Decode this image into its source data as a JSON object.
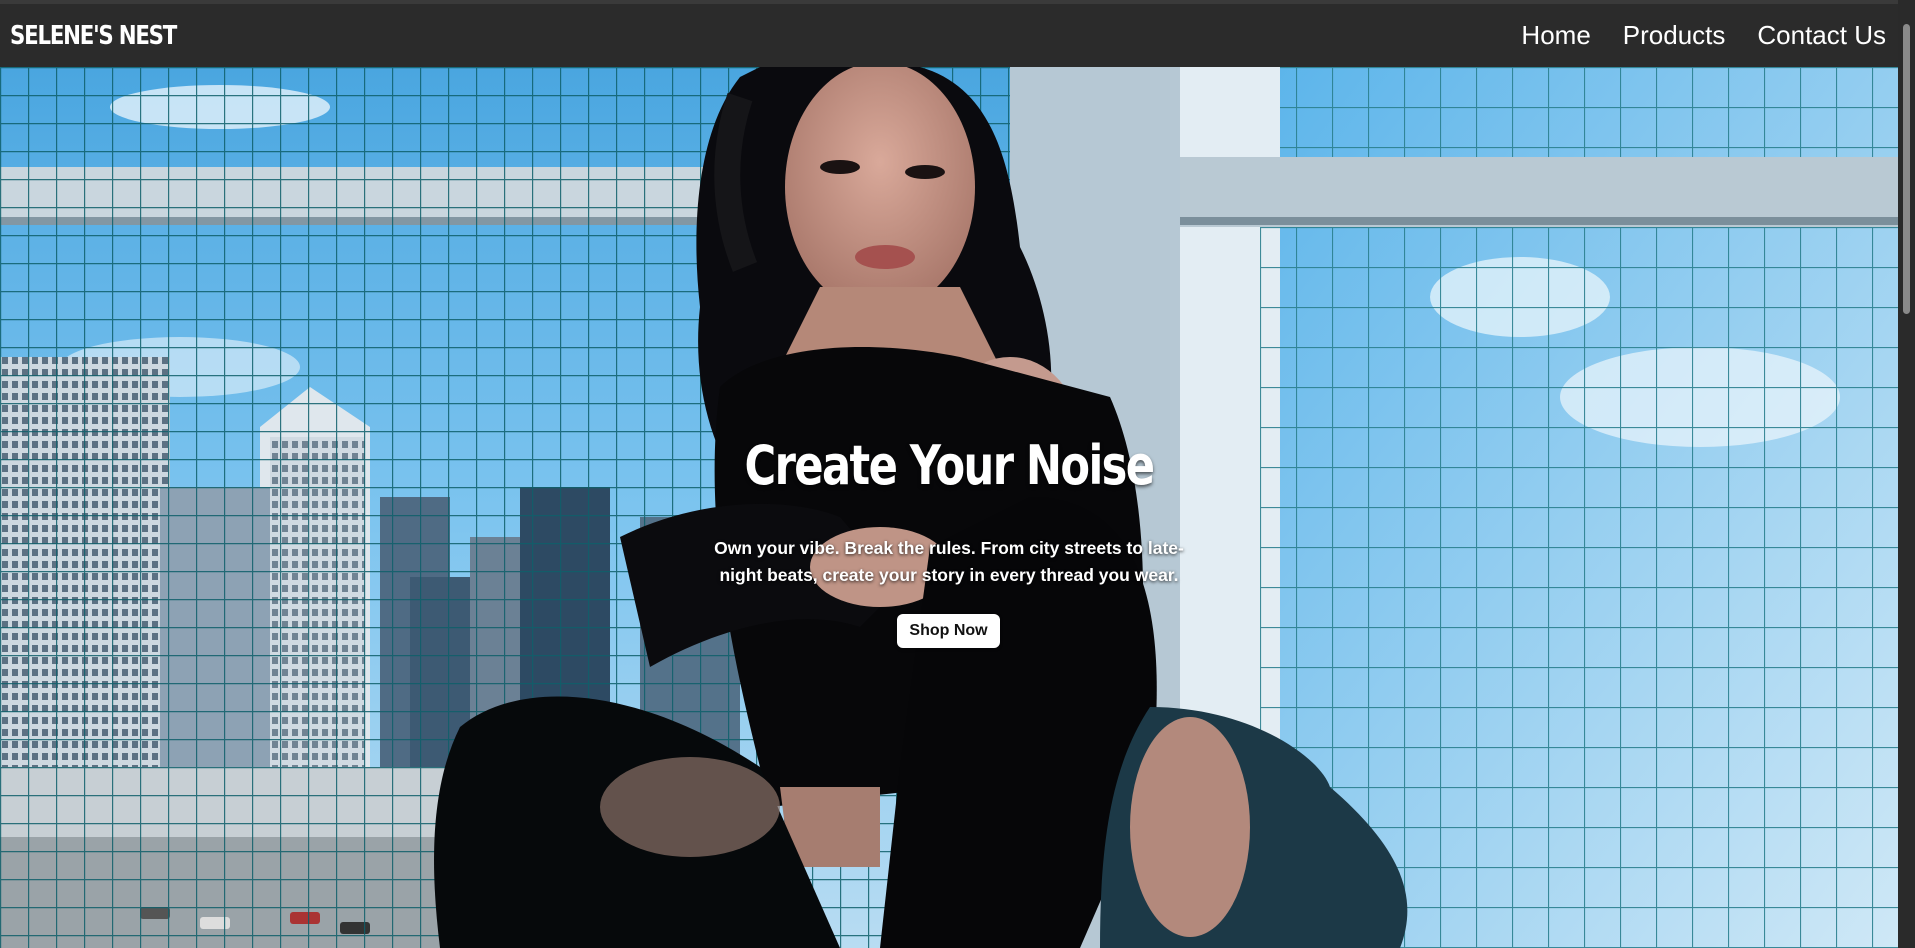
{
  "brand": {
    "name": "SELENE'S NEST"
  },
  "nav": {
    "items": [
      {
        "label": "Home"
      },
      {
        "label": "Products"
      },
      {
        "label": "Contact Us"
      }
    ]
  },
  "hero": {
    "title": "Create Your Noise",
    "description": "Own your vibe. Break the rules. From city streets to late-night beats, create your story in every thread you wear.",
    "cta_label": "Shop Now",
    "image_icon": "hero-photo"
  },
  "colors": {
    "navbar": "#2b2b2b",
    "text": "#ffffff",
    "button_bg": "#ffffff",
    "sky": "#5fb6ea"
  }
}
